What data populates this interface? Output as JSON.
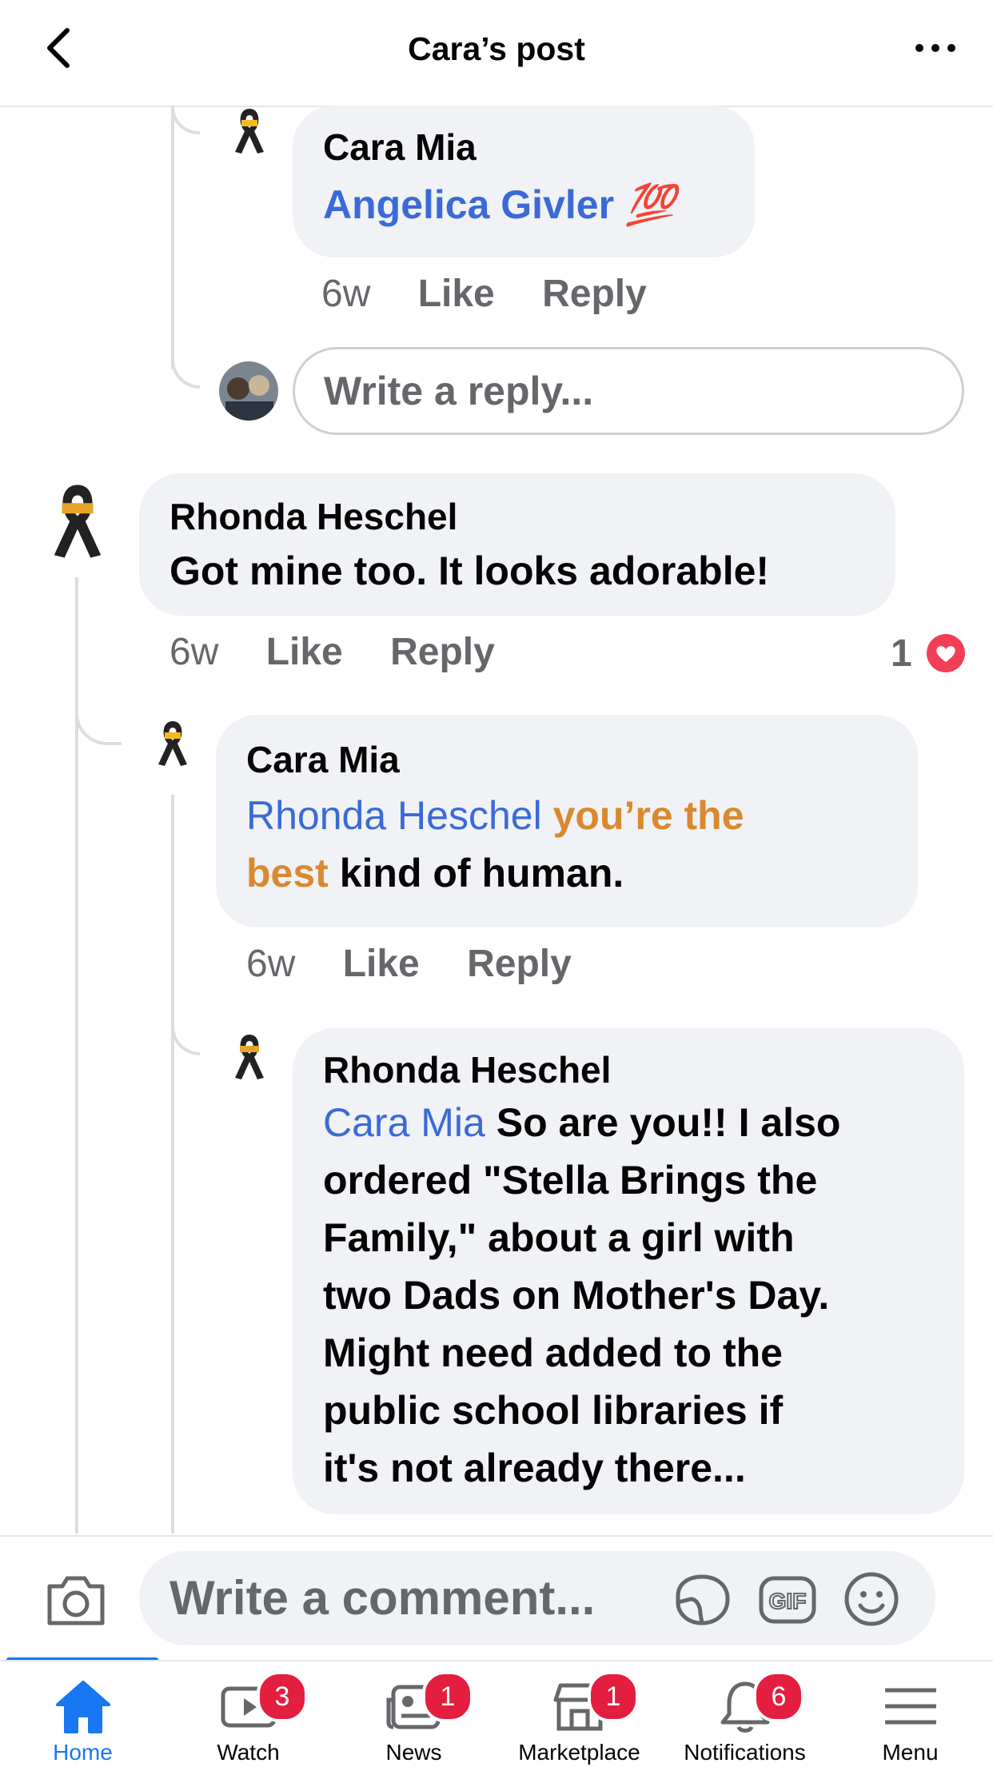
{
  "header": {
    "title": "Cara’s post"
  },
  "comments": [
    {
      "name": "Cara Mia",
      "link": "Angelica Givler",
      "emoji": "💯",
      "age": "6w",
      "like": "Like",
      "reply": "Reply"
    },
    {
      "name": "Rhonda Heschel",
      "text": "Got mine too. It looks adorable!",
      "age": "6w",
      "like": "Like",
      "reply": "Reply",
      "reactions": "1"
    },
    {
      "name": "Cara Mia",
      "link": "Rhonda Heschel",
      "highlight1": "you’re the",
      "highlight2": "best",
      "text": "kind of human.",
      "age": "6w",
      "like": "Like",
      "reply": "Reply"
    },
    {
      "name": "Rhonda Heschel",
      "link": "Cara Mia",
      "lines": [
        "So are you!!  I also",
        "ordered \"Stella Brings the",
        "Family,\" about a girl with",
        "two Dads on Mother's Day.",
        "Might need added to the",
        "public school libraries if",
        "it's not already there..."
      ]
    }
  ],
  "reply_input": {
    "placeholder": "Write a reply..."
  },
  "comment_input": {
    "placeholder": "Write a comment..."
  },
  "tabs": [
    {
      "label": "Home",
      "icon": "home-icon",
      "active": true
    },
    {
      "label": "Watch",
      "icon": "watch-icon",
      "badge": "3"
    },
    {
      "label": "News",
      "icon": "news-icon",
      "badge": "1"
    },
    {
      "label": "Marketplace",
      "icon": "marketplace-icon",
      "badge": "1"
    },
    {
      "label": "Notifications",
      "icon": "bell-icon",
      "badge": "6"
    },
    {
      "label": "Menu",
      "icon": "menu-icon"
    }
  ],
  "colors": {
    "accent": "#1877f2",
    "link": "#3b6ad6",
    "highlight": "#d9892f",
    "badge": "#e41e3f",
    "bubble": "#f0f2f5"
  }
}
